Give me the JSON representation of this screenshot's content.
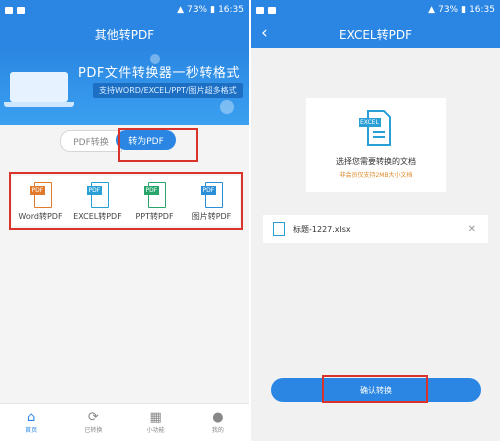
{
  "left": {
    "status": {
      "battery": "73%",
      "time": "16:35"
    },
    "header_title": "其他转PDF",
    "banner": {
      "title": "PDF文件转换器一秒转格式",
      "subtitle": "支持WORD/EXCEL/PPT/图片超多格式"
    },
    "toggle": {
      "off_label": "PDF转换",
      "on_label": "转为PDF"
    },
    "tools": [
      {
        "label": "Word转PDF",
        "tag": "PDF",
        "color": "#e07a2c"
      },
      {
        "label": "EXCEL转PDF",
        "tag": "PDF",
        "color": "#2a9fd6"
      },
      {
        "label": "PPT转PDF",
        "tag": "PDF",
        "color": "#29a56c"
      },
      {
        "label": "图片转PDF",
        "tag": "PDF",
        "color": "#2a8fd6"
      }
    ],
    "nav": [
      {
        "label": "首页",
        "icon": "home-icon"
      },
      {
        "label": "已转换",
        "icon": "refresh-icon"
      },
      {
        "label": "小功能",
        "icon": "grid-icon"
      },
      {
        "label": "我的",
        "icon": "user-icon"
      }
    ]
  },
  "right": {
    "status": {
      "battery": "73%",
      "time": "16:35"
    },
    "header_title": "EXCEL转PDF",
    "card": {
      "icon_tag": "EXCEL",
      "prompt": "选择您需要转换的文档",
      "hint": "非会员仅支持2MB大小文档"
    },
    "file": {
      "name": "标题-1227.xlsx"
    },
    "convert_label": "确认转换"
  },
  "colors": {
    "primary": "#2a86e2",
    "highlight": "#d9342b"
  }
}
